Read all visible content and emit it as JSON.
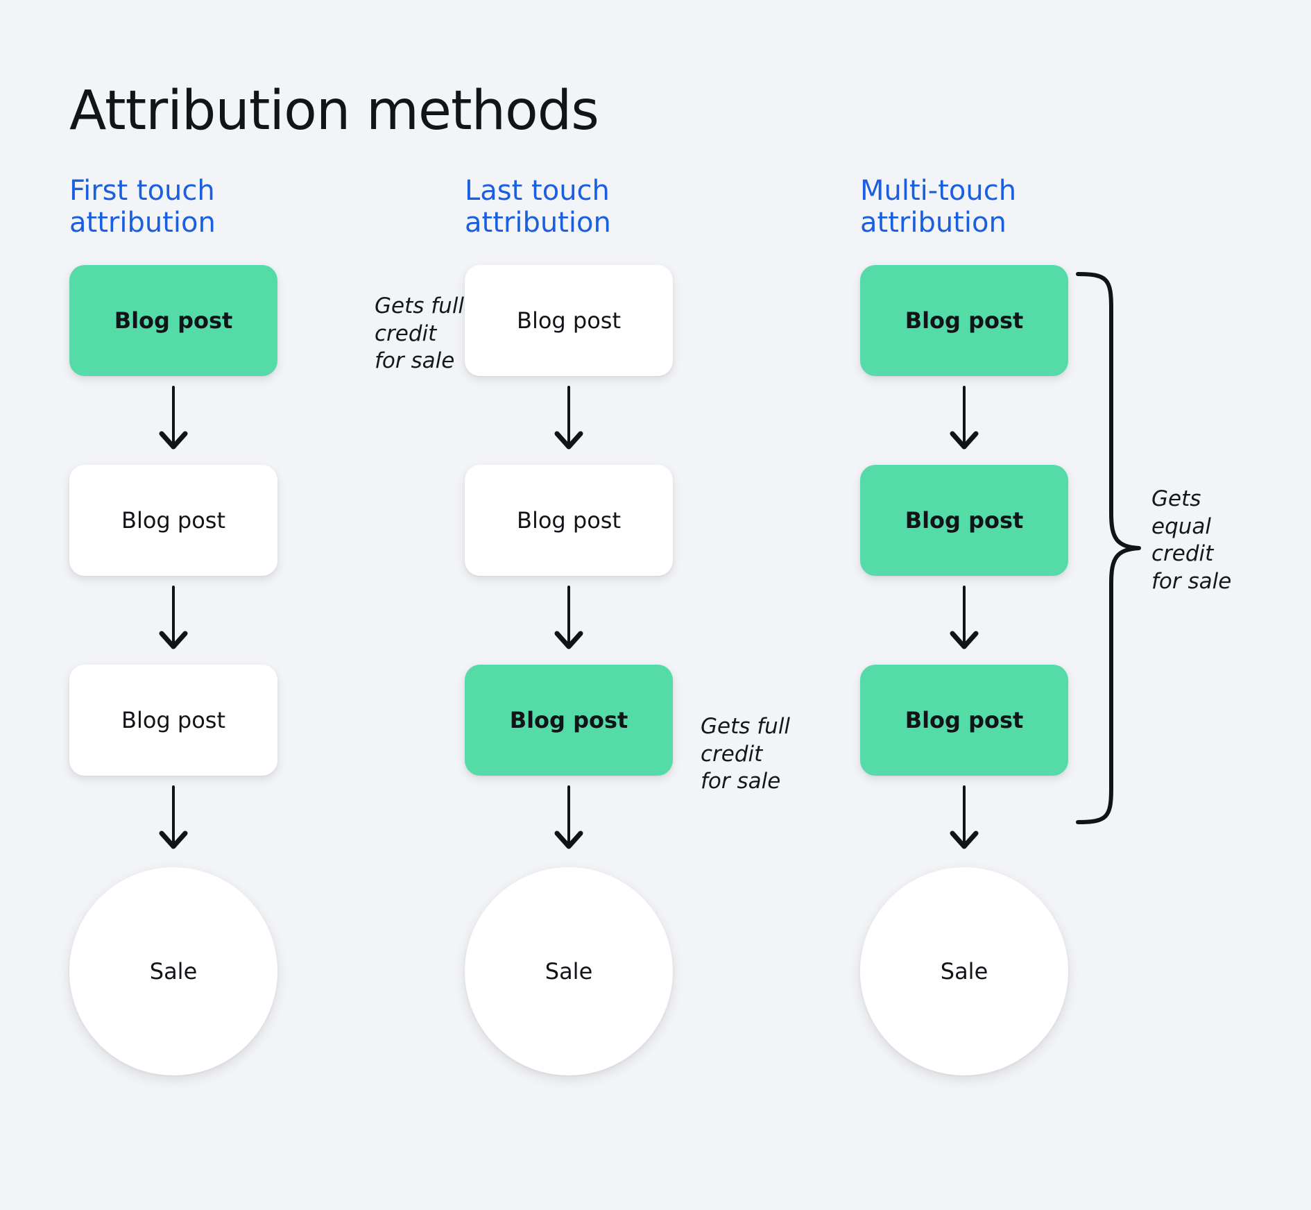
{
  "page": {
    "title": "Attribution methods",
    "background_color": "#f2f4f7",
    "accent_blue": "#1A5FE0",
    "highlight_green": "#55DBA8",
    "card_white": "#ffffff",
    "text_color": "#101418"
  },
  "columns": [
    {
      "id": "first-touch",
      "header_line1": "First touch",
      "header_line2": "attribution",
      "nodes": [
        {
          "label": "Blog post",
          "highlighted": true
        },
        {
          "label": "Blog post",
          "highlighted": false
        },
        {
          "label": "Blog post",
          "highlighted": false
        }
      ],
      "end_node": {
        "label": "Sale"
      },
      "annotation": "Gets full\ncredit\nfor sale",
      "annotation_target_index": 0
    },
    {
      "id": "last-touch",
      "header_line1": "Last touch",
      "header_line2": "attribution",
      "nodes": [
        {
          "label": "Blog post",
          "highlighted": false
        },
        {
          "label": "Blog post",
          "highlighted": false
        },
        {
          "label": "Blog post",
          "highlighted": true
        }
      ],
      "end_node": {
        "label": "Sale"
      },
      "annotation": "Gets full\ncredit\nfor sale",
      "annotation_target_index": 2
    },
    {
      "id": "multi-touch",
      "header_line1": "Multi-touch",
      "header_line2": "attribution",
      "nodes": [
        {
          "label": "Blog post",
          "highlighted": true
        },
        {
          "label": "Blog post",
          "highlighted": true
        },
        {
          "label": "Blog post",
          "highlighted": true
        }
      ],
      "end_node": {
        "label": "Sale"
      },
      "annotation": "Gets\nequal\ncredit\nfor sale",
      "annotation_target_index": -1,
      "has_brace": true
    }
  ]
}
